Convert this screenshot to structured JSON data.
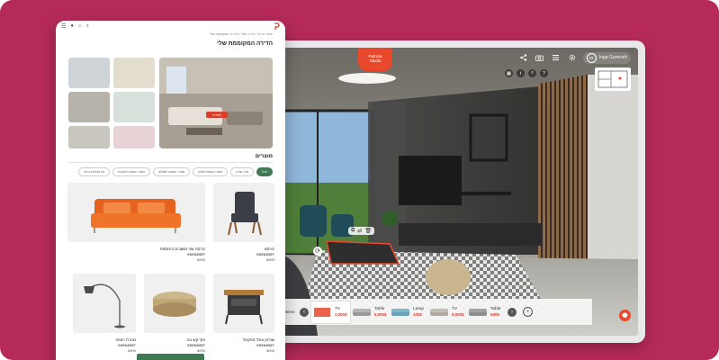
{
  "viewer": {
    "brand_line1": "Patricia",
    "brand_line2": "Studio",
    "user_initials": "IG",
    "user_name": "Inga Gurevich",
    "bar_title": "Items",
    "close_symbol": "×",
    "products": [
      {
        "name": "TV",
        "price": "1,000$"
      },
      {
        "name": "Table",
        "price": "5,000$"
      },
      {
        "name": "Lamp",
        "price": "100$"
      },
      {
        "name": "TV",
        "price": "5,000$"
      },
      {
        "name": "Table",
        "price": "500$"
      }
    ],
    "icons": {
      "share": "share-icon",
      "camera": "camera-icon",
      "list": "list-icon",
      "settings": "gear-icon",
      "help": "help-icon"
    }
  },
  "catalog": {
    "breadcrumb": "עמוד הבית  /  הדירה שלי  /  הדירה המקוממת שלי",
    "title": "הדירה המקוממת שלי",
    "hero_cta": "לצפייה",
    "section_title": "מוצרים",
    "chips": [
      "הכל",
      "חדר שינה",
      "מוצרי השפה לסלון",
      "מוצרי השפה לשולחן",
      "מוצרי השפה למטבח",
      "אל מטלות ביתיו"
    ],
    "products": [
      {
        "name": "כורסא",
        "brand": "EKENÄSET",
        "price": "₪995"
      },
      {
        "name": "כורסה שני מושבים בתוספת",
        "brand": "EKENÄSET",
        "price": "₪995"
      },
      {
        "name": "שולחן אוכל מתקפל",
        "brand": "EKENÄSET",
        "price": "₪995"
      },
      {
        "name": "פוף קש נוח",
        "brand": "EKENÄSET",
        "price": "₪995"
      },
      {
        "name": "מנורת רצפה",
        "brand": "EKENÄSET",
        "price": "₪995"
      }
    ]
  }
}
